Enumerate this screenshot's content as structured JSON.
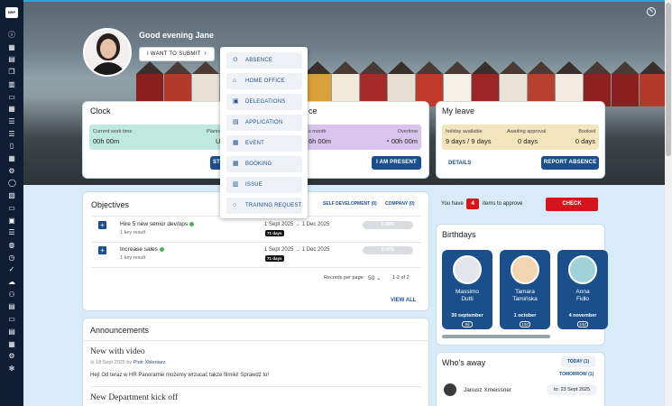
{
  "sidebar": {
    "logo": "HRP",
    "icons": [
      "info-icon",
      "grid-icon",
      "document-icon",
      "copy-icon",
      "file-icon",
      "chat-icon",
      "calendar-icon",
      "list-icon",
      "list-icon",
      "person-icon",
      "calendar-icon",
      "settings-icon",
      "circle-icon",
      "image-icon",
      "chat-icon",
      "book-icon",
      "list-icon",
      "globe-icon",
      "clock-icon",
      "check-icon",
      "cloud-icon",
      "people-icon",
      "document-icon",
      "card-icon",
      "archive-icon",
      "calendar-icon",
      "gear-icon",
      "bug-icon"
    ]
  },
  "header": {
    "greeting": "Good evening Jane",
    "submit_label": "I WANT TO SUBMIT",
    "submit_chevron": "›"
  },
  "submit_menu": [
    {
      "label": "ABSENCE",
      "icon": "person-clock-icon",
      "glyph": "⊙"
    },
    {
      "label": "HOME OFFICE",
      "icon": "home-icon",
      "glyph": "⌂"
    },
    {
      "label": "DELEGATIONS",
      "icon": "suitcase-icon",
      "glyph": "▣"
    },
    {
      "label": "APPLICATION",
      "icon": "document-icon",
      "glyph": "▤"
    },
    {
      "label": "EVENT",
      "icon": "calendar-icon",
      "glyph": "▦"
    },
    {
      "label": "BOOKING",
      "icon": "calendar-plus-icon",
      "glyph": "▦"
    },
    {
      "label": "ISSUE",
      "icon": "trash-icon",
      "glyph": "▥"
    },
    {
      "label": "TRAINING REQUEST",
      "icon": "circle-icon",
      "glyph": "○"
    }
  ],
  "clock": {
    "title": "Clock",
    "work_time_label": "Current work time",
    "work_time_value": "00h 00m",
    "planned_label": "Planned",
    "planned_value": "Uns",
    "button_label": "ST"
  },
  "presence": {
    "title": "ce",
    "month_label": "s month",
    "month_value": "6h 00m",
    "overtime_label": "Overtime",
    "overtime_value": "00h 00m",
    "button_label": "I AM PRESENT"
  },
  "leave": {
    "title": "My leave",
    "holiday_label": "holiday available",
    "holiday_value": "9 days / 9 days",
    "awaiting_label": "Awaiting approval",
    "awaiting_value": "0 days",
    "booked_label": "Booked",
    "booked_value": "0 days",
    "details_label": "DETAILS",
    "report_label": "REPORT ABSENCE"
  },
  "objectives": {
    "title": "Objectives",
    "tabs": [
      "SELF DEVELOPMENT (0)",
      "COMPANY (0)"
    ],
    "items": [
      {
        "title": "Hire 5 new senior dev/ops",
        "sub": "1 key result",
        "dates": "1 Sept 2025 → 1 Dec 2025",
        "days": "71 days",
        "progress": "0.00%",
        "progress_value": 0
      },
      {
        "title": "Increase sales",
        "sub": "1 key result",
        "dates": "1 Sept 2025 → 1 Dec 2025",
        "days": "71 days",
        "progress": "0.00%",
        "progress_value": 0
      }
    ],
    "records_label": "Records per page:",
    "records_value": "50",
    "range": "1-2 of 2",
    "view_all": "VIEW ALL"
  },
  "approve": {
    "prefix": "You have",
    "count": "4",
    "suffix": "items to approve",
    "button": "CHECK"
  },
  "birthdays": {
    "title": "Birthdays",
    "people": [
      {
        "first": "Massimo",
        "last": "Dutti",
        "date": "30 september",
        "days": "9d"
      },
      {
        "first": "Tamara",
        "last": "Tamińska",
        "date": "1 october",
        "days": "10d"
      },
      {
        "first": "Anna",
        "last": "Fidło",
        "date": "4 november",
        "days": "44d"
      }
    ]
  },
  "announcements": {
    "title": "Announcements",
    "items": [
      {
        "title": "New with video",
        "date": "18 Sept 2025 by",
        "author": "Piotr Xbłoniarz",
        "body": "Hej!  Od teraz w HR Panoramie możemy wrzucać także filmiki! Sprawdź to!"
      },
      {
        "title": "New Department kick off"
      }
    ]
  },
  "whos_away": {
    "title": "Who's away",
    "today": "TODAY (1)",
    "tomorrow": "TOMORROW (1)",
    "person": "Janusz Xmeissner",
    "until": "to: 23 Sept 2025"
  },
  "colors": {
    "primary": "#1b4f8b",
    "accent_red": "#d6141c",
    "sidebar": "#0f1d33",
    "clock_green": "#bfe8de",
    "presence_purple": "#d8c4ec",
    "leave_beige": "#f3e5bb"
  }
}
